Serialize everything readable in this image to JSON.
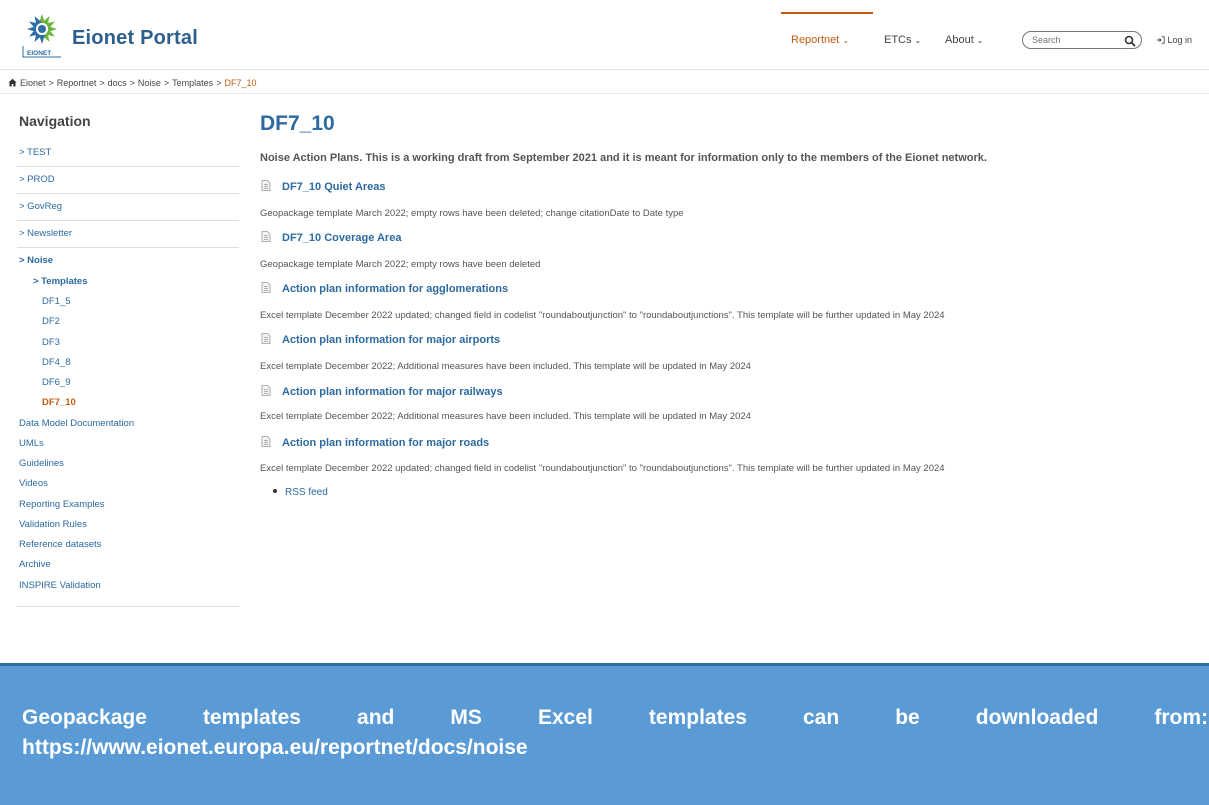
{
  "header": {
    "title": "Eionet Portal",
    "logo_text": "EIONET",
    "nav": [
      {
        "label": "Reportnet",
        "caret": "⌄"
      },
      {
        "label": "ETCs",
        "caret": "⌄"
      },
      {
        "label": "About",
        "caret": "⌄"
      }
    ],
    "search_placeholder": "Search",
    "login_label": "Log in"
  },
  "breadcrumb": [
    {
      "label": "Eionet"
    },
    {
      "label": "Reportnet"
    },
    {
      "label": "docs"
    },
    {
      "label": "Noise"
    },
    {
      "label": "Templates"
    },
    {
      "label": "DF7_10"
    }
  ],
  "breadcrumb_sep": ">",
  "sidebar": {
    "title": "Navigation",
    "items": [
      {
        "label": "> TEST"
      },
      {
        "label": "> PROD"
      },
      {
        "label": "> GovReg"
      },
      {
        "label": "> Newsletter"
      },
      {
        "label": "> Noise"
      },
      {
        "label": "> Templates"
      },
      {
        "label": "DF1_5"
      },
      {
        "label": "DF2"
      },
      {
        "label": "DF3"
      },
      {
        "label": "DF4_8"
      },
      {
        "label": "DF6_9"
      },
      {
        "label": "DF7_10"
      },
      {
        "label": "Data Model Documentation"
      },
      {
        "label": "UMLs"
      },
      {
        "label": "Guidelines"
      },
      {
        "label": "Videos"
      },
      {
        "label": "Reporting Examples"
      },
      {
        "label": "Validation Rules"
      },
      {
        "label": "Reference datasets"
      },
      {
        "label": "Archive"
      },
      {
        "label": "INSPIRE Validation"
      }
    ]
  },
  "main": {
    "title": "DF7_10",
    "intro": "Noise Action Plans. This is a working draft from September 2021 and it is meant for information only to the members of the Eionet network.",
    "documents": [
      {
        "title": "DF7_10 Quiet Areas",
        "description": "Geopackage template March 2022; empty rows have been deleted; change citationDate to Date type"
      },
      {
        "title": "DF7_10 Coverage Area",
        "description": "Geopackage template March 2022; empty rows have been deleted"
      },
      {
        "title": "Action plan information for agglomerations",
        "description": "Excel template December 2022 updated; changed field in codelist \"roundaboutjunction\" to \"roundaboutjunctions\". This template will be further updated in May 2024"
      },
      {
        "title": "Action plan information for major airports",
        "description": "Excel template December 2022; Additional measures have been included. This template will be updated in May 2024"
      },
      {
        "title": "Action plan information for major railways",
        "description": "Excel template December 2022; Additional measures have been included. This template will be updated in May 2024"
      },
      {
        "title": "Action plan information for major roads",
        "description": "Excel template December 2022 updated; changed field in codelist \"roundaboutjunction\" to \"roundaboutjunctions\". This template will be further updated in May 2024"
      }
    ],
    "rss_label": "RSS feed"
  },
  "banner": {
    "text": "Geopackage templates and MS Excel templates can be downloaded from: https://www.eionet.europa.eu/reportnet/docs/noise"
  },
  "colors": {
    "brand": "#2c5f8d",
    "link": "#2c6aa0",
    "active": "#c55a11",
    "banner_bg": "#5b9bd5"
  }
}
